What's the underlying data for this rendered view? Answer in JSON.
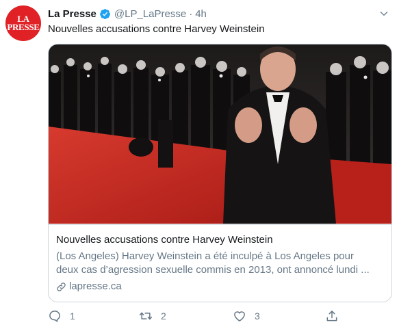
{
  "account": {
    "avatar_line1": "LA",
    "avatar_line2": "PRESSE",
    "name": "La Presse",
    "handle": "@LP_LaPresse",
    "separator": "·",
    "time": "4h",
    "verified": true
  },
  "tweet": {
    "text": "Nouvelles accusations contre Harvey Weinstein"
  },
  "card": {
    "title": "Nouvelles accusations contre Harvey Weinstein",
    "description_line1": "(Los Angeles) Harvey Weinstein a été inculpé à Los Angeles pour",
    "description_line2": "deux cas d’agression sexuelle commis en 2013, ont annoncé lundi ...",
    "domain": "lapresse.ca"
  },
  "actions": {
    "reply_count": "1",
    "retweet_count": "2",
    "like_count": "3"
  },
  "colors": {
    "brand_red": "#e02126",
    "verified_blue": "#1da1f2",
    "secondary_text": "#657786",
    "border": "#ccd6dd",
    "carpet_red": "#c8241d"
  },
  "icons": [
    "verified-badge-icon",
    "chevron-down-icon",
    "link-icon",
    "reply-icon",
    "retweet-icon",
    "like-icon",
    "share-icon"
  ]
}
